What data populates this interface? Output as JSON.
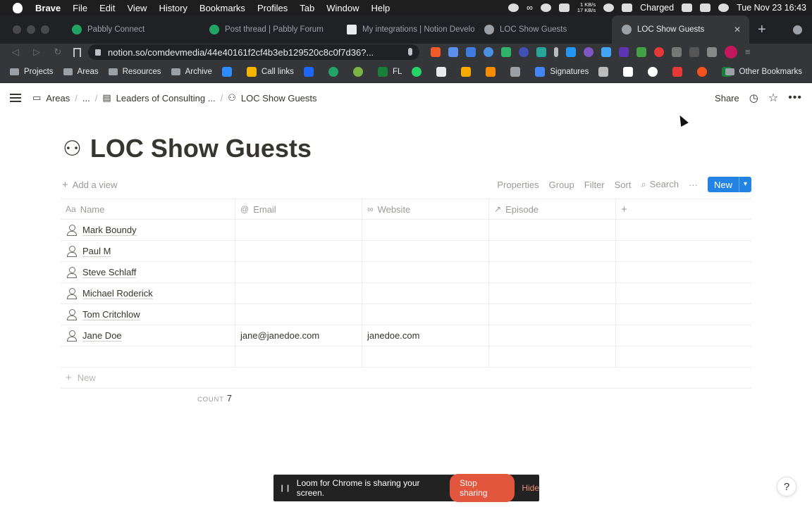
{
  "menubar": {
    "app": "Brave",
    "items": [
      "File",
      "Edit",
      "View",
      "History",
      "Bookmarks",
      "Profiles",
      "Tab",
      "Window",
      "Help"
    ],
    "battery_status": "Charged",
    "datetime": "Tue Nov 23  16:43",
    "net_up": "1 KB/s",
    "net_down": "17 KB/s",
    "infinity": "∞"
  },
  "tabs": [
    {
      "label": "Pabbly Connect",
      "color": "#21a366"
    },
    {
      "label": "Post thread | Pabbly Forum",
      "color": "#21a366"
    },
    {
      "label": "My integrations | Notion Develo",
      "color": "#e8eaed"
    },
    {
      "label": "LOC Show Guests",
      "color": "#9aa0a6"
    },
    {
      "label": "LOC Show Guests",
      "color": "#9aa0a6",
      "active": true
    }
  ],
  "toolbar": {
    "url": "notion.so/comdevmedia/44e40161f2cf4b3eb129520c8c0f7d36?..."
  },
  "bookmarks": {
    "folders": [
      "Projects",
      "Areas",
      "Resources",
      "Archive"
    ],
    "call_links": "Call links",
    "fl": "FL",
    "signatures": "Signatures",
    "other": "Other Bookmarks"
  },
  "breadcrumb": {
    "areas": "Areas",
    "ellipsis": "...",
    "parent": "Leaders of Consulting ...",
    "current": "LOC Show Guests"
  },
  "topbar": {
    "share": "Share"
  },
  "page": {
    "title": "LOC Show Guests"
  },
  "viewbar": {
    "add_view": "Add a view",
    "properties": "Properties",
    "group": "Group",
    "filter": "Filter",
    "sort": "Sort",
    "search": "Search",
    "more": "···",
    "new": "New"
  },
  "table": {
    "headers": [
      "Name",
      "Email",
      "Website",
      "Episode"
    ],
    "rows": [
      {
        "name": "Mark Boundy",
        "email": "",
        "website": "",
        "episode": ""
      },
      {
        "name": "Paul M",
        "email": "",
        "website": "",
        "episode": ""
      },
      {
        "name": "Steve Schlaff",
        "email": "",
        "website": "",
        "episode": ""
      },
      {
        "name": "Michael Roderick",
        "email": "",
        "website": "",
        "episode": ""
      },
      {
        "name": "Tom Critchlow",
        "email": "",
        "website": "",
        "episode": ""
      },
      {
        "name": "Jane Doe",
        "email": "jane@janedoe.com",
        "website": "janedoe.com",
        "episode": ""
      },
      {
        "name": "",
        "email": "",
        "website": "",
        "episode": ""
      }
    ],
    "new_row": "New",
    "count_label": "COUNT",
    "count_value": "7"
  },
  "loom": {
    "message": "Loom for Chrome is sharing your screen.",
    "stop": "Stop sharing",
    "hide": "Hide"
  },
  "help": "?"
}
